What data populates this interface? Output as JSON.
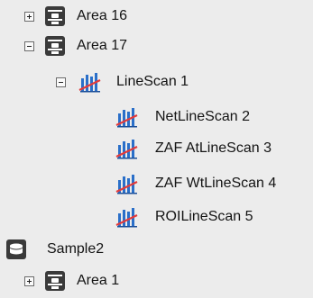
{
  "tree": {
    "items": [
      {
        "label": "Area 16",
        "expander": "plus",
        "icon": "area-icon"
      },
      {
        "label": "Area 17",
        "expander": "minus",
        "icon": "area-icon"
      },
      {
        "label": "LineScan 1",
        "expander": "minus",
        "icon": "linescan-icon"
      },
      {
        "label": "NetLineScan 2",
        "icon": "linescan-sub-icon"
      },
      {
        "label": "ZAF AtLineScan 3",
        "icon": "linescan-sub-icon"
      },
      {
        "label": "ZAF WtLineScan 4",
        "icon": "linescan-sub-icon"
      },
      {
        "label": "ROILineScan 5",
        "icon": "linescan-sub-icon"
      },
      {
        "label": "Sample2",
        "icon": "sample-icon"
      },
      {
        "label": "Area 1",
        "expander": "plus",
        "icon": "area-icon"
      }
    ]
  },
  "colors": {
    "background": "#ececec",
    "text": "#141414",
    "area_icon": "#3a3a3a",
    "bars": "#2a6fc9",
    "line": "#e23b3b"
  }
}
